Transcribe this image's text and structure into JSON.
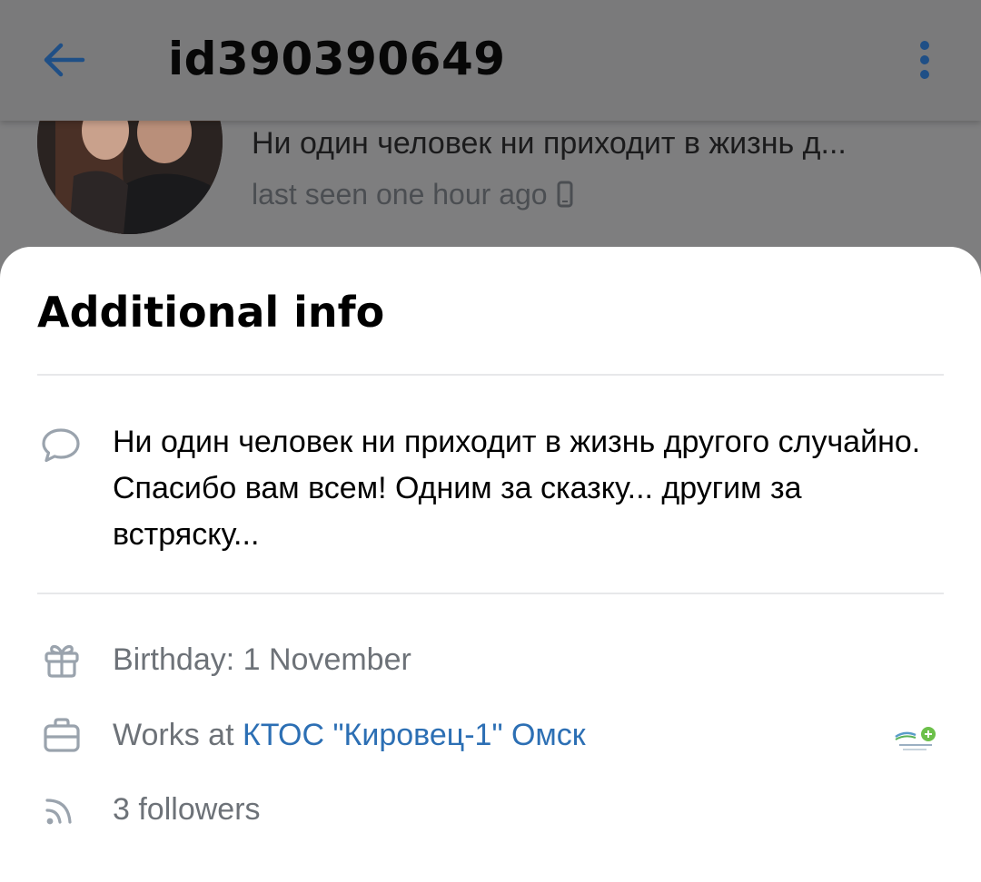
{
  "topbar": {
    "title": "id390390649",
    "back_icon": "arrow-left-icon",
    "more_icon": "more-vertical-icon"
  },
  "profile": {
    "status": "Ни один человек ни приходит в жизнь д...",
    "last_seen": "last seen one hour ago",
    "device_icon": "mobile-phone-icon"
  },
  "sheet": {
    "title": "Additional info",
    "about": {
      "icon": "speech-bubble-icon",
      "text": "Ни один человек ни приходит в жизнь другого случайно. Спасибо вам всем! Одним за сказку... другим за встряску..."
    },
    "birthday": {
      "icon": "gift-icon",
      "text": "Birthday: 1 November"
    },
    "work": {
      "icon": "briefcase-icon",
      "prefix": "Works at ",
      "org": "КТОС \"Кировец-1\" Омск"
    },
    "followers": {
      "icon": "rss-followers-icon",
      "text": "3 followers"
    }
  },
  "colors": {
    "accent": "#2c6fb4",
    "secondary_text": "#6d7278",
    "icon": "#9aa3ad",
    "dim_overlay": "#7e7e7f"
  }
}
